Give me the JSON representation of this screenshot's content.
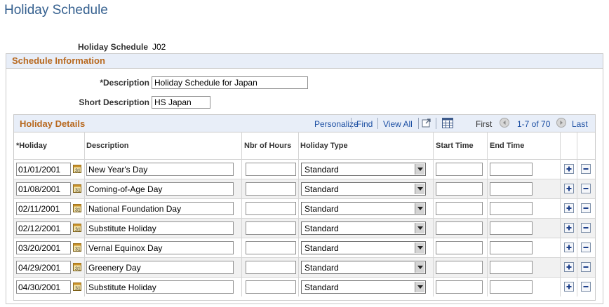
{
  "page": {
    "title": "Holiday Schedule"
  },
  "holiday_schedule": {
    "label": "Holiday Schedule",
    "value": "J02"
  },
  "schedule_info": {
    "title": "Schedule Information",
    "description_label": "*Description",
    "description_value": "Holiday Schedule for Japan",
    "short_description_label": "Short Description",
    "short_description_value": "HS Japan"
  },
  "grid": {
    "title": "Holiday Details",
    "personalize": "Personalize",
    "find": "Find",
    "view_all": "View All",
    "first": "First",
    "range": "1-7 of 70",
    "last": "Last",
    "columns": {
      "holiday": "*Holiday",
      "description": "Description",
      "nbr_hours": "Nbr of Hours",
      "holiday_type": "Holiday Type",
      "start_time": "Start Time",
      "end_time": "End Time"
    },
    "rows": [
      {
        "holiday": "01/01/2001",
        "description": "New Year's Day",
        "nbr_hours": "",
        "holiday_type": "Standard",
        "start_time": "",
        "end_time": ""
      },
      {
        "holiday": "01/08/2001",
        "description": "Coming-of-Age Day",
        "nbr_hours": "",
        "holiday_type": "Standard",
        "start_time": "",
        "end_time": ""
      },
      {
        "holiday": "02/11/2001",
        "description": "National Foundation Day",
        "nbr_hours": "",
        "holiday_type": "Standard",
        "start_time": "",
        "end_time": ""
      },
      {
        "holiday": "02/12/2001",
        "description": "Substitute Holiday",
        "nbr_hours": "",
        "holiday_type": "Standard",
        "start_time": "",
        "end_time": ""
      },
      {
        "holiday": "03/20/2001",
        "description": "Vernal Equinox Day",
        "nbr_hours": "",
        "holiday_type": "Standard",
        "start_time": "",
        "end_time": ""
      },
      {
        "holiday": "04/29/2001",
        "description": "Greenery Day",
        "nbr_hours": "",
        "holiday_type": "Standard",
        "start_time": "",
        "end_time": ""
      },
      {
        "holiday": "04/30/2001",
        "description": "Substitute Holiday",
        "nbr_hours": "",
        "holiday_type": "Standard",
        "start_time": "",
        "end_time": ""
      }
    ]
  },
  "icons": {
    "calendar": "calendar-icon",
    "add_row": "plus-icon",
    "delete_row": "minus-icon",
    "zoom": "zoom-icon",
    "download": "spreadsheet-icon",
    "prev": "left-arrow-icon",
    "next": "right-arrow-icon"
  },
  "colors": {
    "title_blue": "#35608f",
    "section_orange": "#b8691f",
    "link_blue": "#1c4fa3",
    "header_bg": "#e8eef8"
  }
}
